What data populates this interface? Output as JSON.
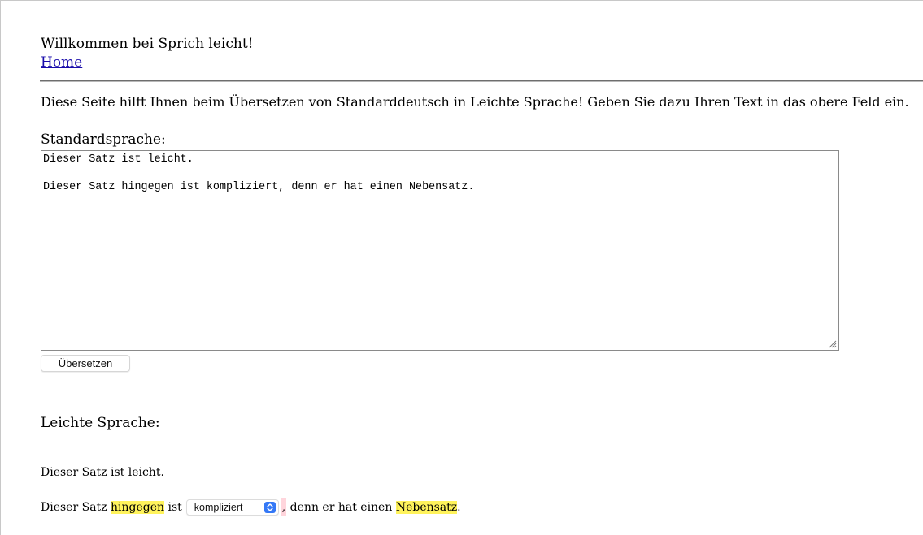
{
  "header": {
    "welcome": "Willkommen bei Sprich leicht!",
    "home_link": "Home"
  },
  "intro": "Diese Seite hilft Ihnen beim Übersetzen von Standarddeutsch in Leichte Sprache! Geben Sie dazu Ihren Text in das obere Feld ein.",
  "standard": {
    "label": "Standardsprache:",
    "text": "Dieser Satz ist leicht.\n\nDieser Satz hingegen ist kompliziert, denn er hat einen Nebensatz."
  },
  "translate_button": "Übersetzen",
  "easy": {
    "label": "Leichte Sprache:",
    "line1": "Dieser Satz ist leicht.",
    "line2": {
      "part1": "Dieser Satz ",
      "highlight1": "hingegen",
      "part2": " ist",
      "select_value": "kompliziert",
      "comma": ",",
      "part3": " denn er hat einen ",
      "highlight2": "Nebensatz",
      "part4": "."
    }
  },
  "colors": {
    "highlight": "#fff35c",
    "comma_highlight": "#ffd5dc",
    "select_accent": "#3478f6",
    "link": "#1a0dab"
  },
  "icons": {
    "resize_grip": "resize-grip-icon",
    "select_arrows": "updown-chevron-icon"
  }
}
